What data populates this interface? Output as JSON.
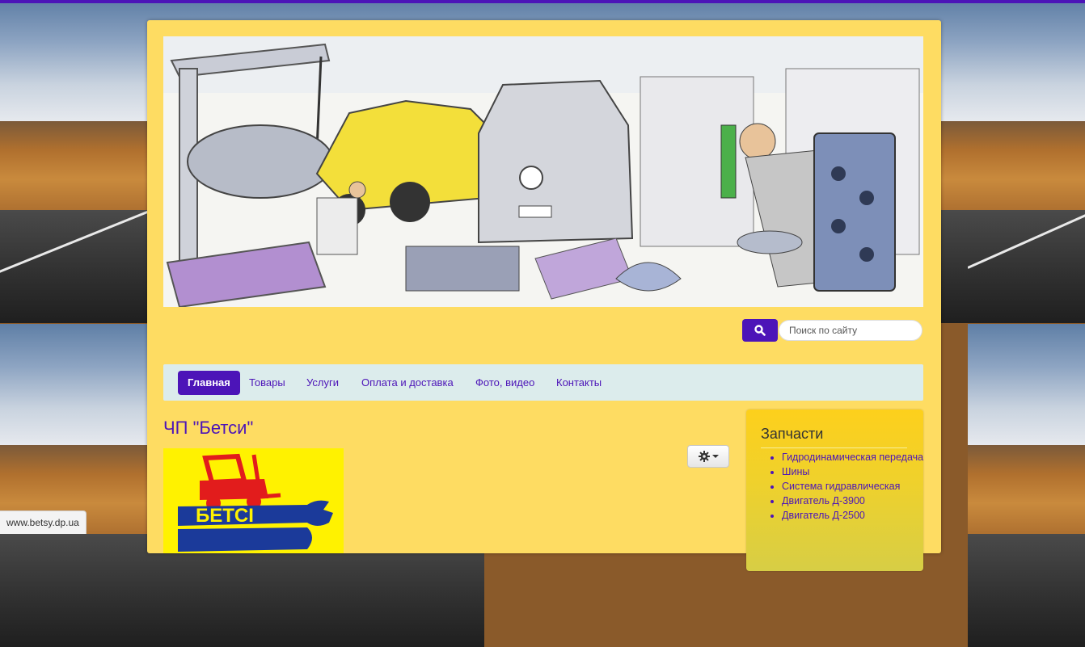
{
  "search": {
    "placeholder": "Поиск по сайту"
  },
  "nav": {
    "items": [
      {
        "label": "Главная"
      },
      {
        "label": "Товары"
      },
      {
        "label": "Услуги"
      },
      {
        "label": "Оплата и доставка"
      },
      {
        "label": "Фото, видео"
      },
      {
        "label": "Контакты"
      }
    ],
    "active_index": 0
  },
  "page": {
    "title": "ЧП \"Бетси\""
  },
  "logo": {
    "text": "БЕТСІ"
  },
  "sidebar": {
    "title": "Запчасти",
    "items": [
      {
        "label": "Гидродинамическая передача"
      },
      {
        "label": "Шины"
      },
      {
        "label": "Система гидравлическая"
      },
      {
        "label": "Двигатель Д-3900"
      },
      {
        "label": "Двигатель Д-2500"
      }
    ]
  },
  "status_bar": {
    "url": "www.betsy.dp.ua"
  },
  "icons": {
    "search": "search-icon",
    "gear": "gear-icon",
    "caret": "caret-down-icon"
  },
  "colors": {
    "accent": "#4c14b8",
    "page_bg": "#fedc62",
    "navbar_bg": "#dcecec",
    "logo_bg": "#fff200",
    "sidebar_bg": "#fdd01c"
  }
}
